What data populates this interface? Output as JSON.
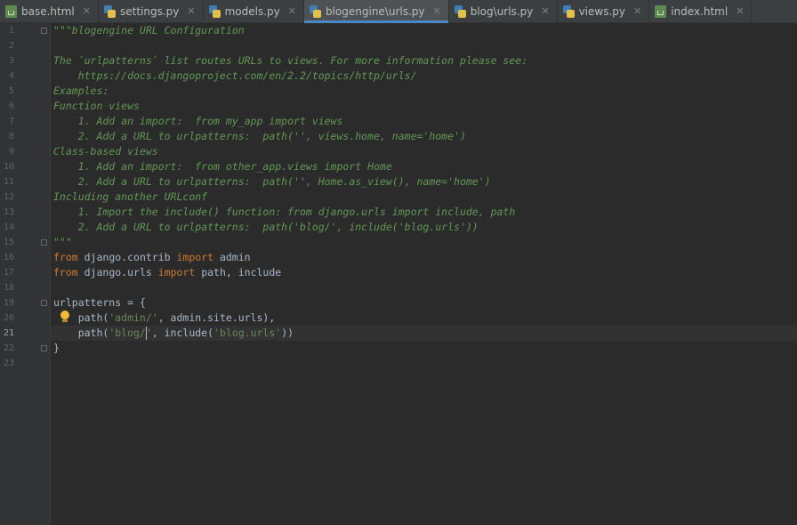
{
  "tabs": [
    {
      "label": "base.html",
      "icon": "html-file-icon"
    },
    {
      "label": "settings.py",
      "icon": "python-file-icon"
    },
    {
      "label": "models.py",
      "icon": "python-file-icon"
    },
    {
      "label": "blogengine\\urls.py",
      "icon": "python-file-icon",
      "active": true
    },
    {
      "label": "blog\\urls.py",
      "icon": "python-file-icon"
    },
    {
      "label": "views.py",
      "icon": "python-file-icon"
    },
    {
      "label": "index.html",
      "icon": "html-file-icon"
    }
  ],
  "close_glyph": "✕",
  "editor": {
    "current_line": 21,
    "line_numbers": [
      "1",
      "2",
      "3",
      "4",
      "5",
      "6",
      "7",
      "8",
      "9",
      "10",
      "11",
      "12",
      "13",
      "14",
      "15",
      "16",
      "17",
      "18",
      "19",
      "20",
      "21",
      "22",
      "23"
    ],
    "lines": [
      [
        {
          "t": "\"\"\"blogengine URL Configuration",
          "c": "doc"
        }
      ],
      [],
      [
        {
          "t": "The `urlpatterns` list routes URLs to views. For more information please see:",
          "c": "doc"
        }
      ],
      [
        {
          "t": "    https://docs.djangoproject.com/en/2.2/topics/http/urls/",
          "c": "doc"
        }
      ],
      [
        {
          "t": "Examples:",
          "c": "doc"
        }
      ],
      [
        {
          "t": "Function views",
          "c": "doc"
        }
      ],
      [
        {
          "t": "    1. Add an import:  from my_app import views",
          "c": "doc"
        }
      ],
      [
        {
          "t": "    2. Add a URL to urlpatterns:  path('', views.home, name='home')",
          "c": "doc"
        }
      ],
      [
        {
          "t": "Class-based views",
          "c": "doc"
        }
      ],
      [
        {
          "t": "    1. Add an import:  from other_app.views import Home",
          "c": "doc"
        }
      ],
      [
        {
          "t": "    2. Add a URL to urlpatterns:  path('', Home.as_view(), name='home')",
          "c": "doc"
        }
      ],
      [
        {
          "t": "Including another URLconf",
          "c": "doc"
        }
      ],
      [
        {
          "t": "    1. Import the include() function: from django.urls import include, path",
          "c": "doc"
        }
      ],
      [
        {
          "t": "    2. Add a URL to urlpatterns:  path('blog/', include('blog.urls'))",
          "c": "doc"
        }
      ],
      [
        {
          "t": "\"\"\"",
          "c": "doc"
        }
      ],
      [
        {
          "t": "from",
          "c": "kw"
        },
        {
          "t": " django.contrib ",
          "c": "plain"
        },
        {
          "t": "import",
          "c": "kw"
        },
        {
          "t": " admin",
          "c": "plain"
        }
      ],
      [
        {
          "t": "from",
          "c": "kw"
        },
        {
          "t": " django.urls ",
          "c": "plain"
        },
        {
          "t": "import",
          "c": "kw"
        },
        {
          "t": " path, include",
          "c": "plain"
        }
      ],
      [],
      [
        {
          "t": "urlpatterns = {",
          "c": "plain"
        }
      ],
      [
        {
          "t": "    path(",
          "c": "plain"
        },
        {
          "t": "'admin/'",
          "c": "str"
        },
        {
          "t": ", admin.site.urls),",
          "c": "plain"
        }
      ],
      [
        {
          "t": "    path(",
          "c": "plain"
        },
        {
          "t": "'blog/'",
          "c": "str"
        },
        {
          "t": ", include(",
          "c": "plain"
        },
        {
          "t": "'blog.urls'",
          "c": "str"
        },
        {
          "t": "))",
          "c": "plain"
        }
      ],
      [
        {
          "t": "}",
          "c": "plain"
        }
      ],
      []
    ]
  }
}
